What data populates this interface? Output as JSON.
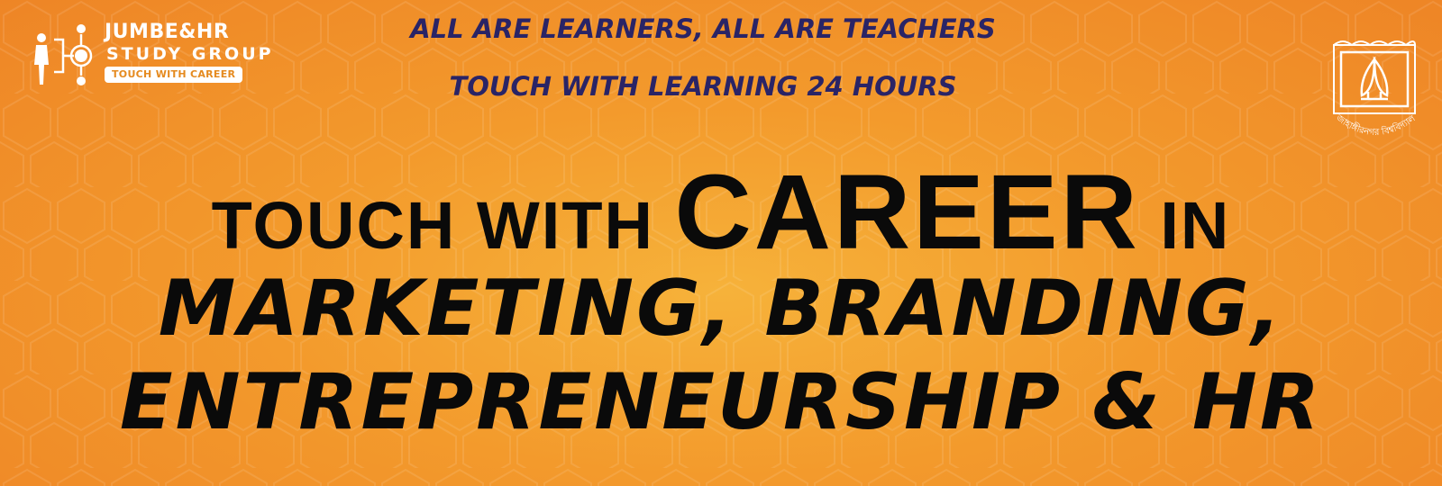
{
  "logo": {
    "title": "JUMBE&HR",
    "subtitle": "STUDY GROUP",
    "pill": "TOUCH WITH CAREER",
    "icon": "people-network-icon"
  },
  "taglines": {
    "line1": "ALL ARE LEARNERS, ALL ARE TEACHERS",
    "line2": "TOUCH WITH LEARNING 24 HOURS"
  },
  "headline": {
    "part1": "TOUCH WITH ",
    "part2": "CAREER",
    "part3": " IN",
    "line2": "MARKETING, BRANDING,",
    "line3": "ENTREPRENEURSHIP & HR"
  },
  "seal": {
    "icon": "university-seal-icon",
    "text": "জাহাঙ্গীরনগর বিশ্ববিদ্যালয়"
  },
  "colors": {
    "background": "#f39a2c",
    "tagline": "#2a2466",
    "headline": "#0a0a0a",
    "logo": "#ffffff"
  }
}
